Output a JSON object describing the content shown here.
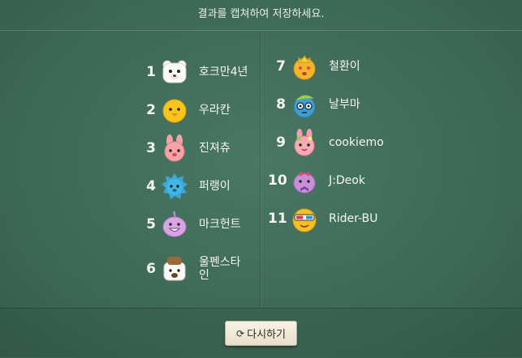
{
  "header": {
    "title": "결과를 캡쳐하여 저장하세요."
  },
  "left_column": [
    {
      "rank": "1",
      "name": "호크만4년",
      "avatar": "polar-bear-icon"
    },
    {
      "rank": "2",
      "name": "우라칸",
      "avatar": "chick-icon"
    },
    {
      "rank": "3",
      "name": "진져츄",
      "avatar": "pink-rabbit-icon"
    },
    {
      "rank": "4",
      "name": "퍼랭이",
      "avatar": "blue-spiky-icon"
    },
    {
      "rank": "5",
      "name": "마크헌트",
      "avatar": "purple-blob-icon"
    },
    {
      "rank": "6",
      "name": "울펜스타인",
      "avatar": "bear-hat-icon"
    }
  ],
  "right_column": [
    {
      "rank": "7",
      "name": "철환이",
      "avatar": "crowned-face-icon"
    },
    {
      "rank": "8",
      "name": "날부마",
      "avatar": "blue-glasses-icon"
    },
    {
      "rank": "9",
      "name": "cookiemo",
      "avatar": "rabbit-flower-icon"
    },
    {
      "rank": "10",
      "name": "J:Deok",
      "avatar": "purple-bow-icon"
    },
    {
      "rank": "11",
      "name": "Rider-BU",
      "avatar": "yellow-3d-glasses-icon"
    }
  ],
  "footer": {
    "retry_label": "다시하기",
    "retry_icon": "refresh-icon"
  },
  "colors": {
    "background": "#3f6a58",
    "button": "#f0ead8",
    "text": "#ffffff"
  }
}
